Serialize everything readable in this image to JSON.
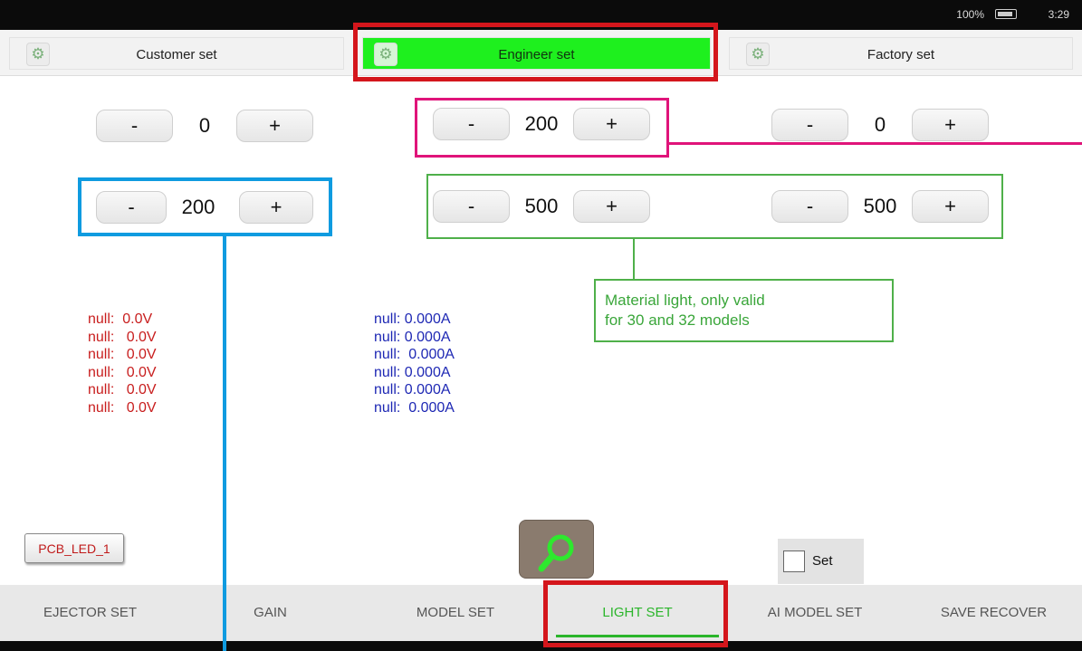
{
  "status_bar": {
    "battery": "100%",
    "time": "3:29"
  },
  "mode_tabs": [
    {
      "label": "Customer set",
      "active": false
    },
    {
      "label": "Engineer set",
      "active": true
    },
    {
      "label": "Factory set",
      "active": false
    }
  ],
  "steppers": {
    "customer_1": {
      "minus": "-",
      "value": "0",
      "plus": "+"
    },
    "customer_2": {
      "minus": "-",
      "value": "200",
      "plus": "+"
    },
    "engineer_1": {
      "minus": "-",
      "value": "200",
      "plus": "+"
    },
    "engineer_2": {
      "minus": "-",
      "value": "500",
      "plus": "+"
    },
    "factory_1": {
      "minus": "-",
      "value": "0",
      "plus": "+"
    },
    "factory_2": {
      "minus": "-",
      "value": "500",
      "plus": "+"
    }
  },
  "voltages": [
    "null:  0.0V",
    "null:   0.0V",
    "null:   0.0V",
    "null:   0.0V",
    "null:   0.0V",
    "null:   0.0V"
  ],
  "currents": [
    "null: 0.000A",
    "null: 0.000A",
    "null:  0.000A",
    "null: 0.000A",
    "null: 0.000A",
    "null:  0.000A"
  ],
  "pcb_button": "PCB_LED_1",
  "set_checkbox": {
    "label": "Set",
    "checked": false
  },
  "bottom_nav": [
    {
      "label": "EJECTOR SET",
      "active": false
    },
    {
      "label": "GAIN",
      "active": false
    },
    {
      "label": "MODEL SET",
      "active": false
    },
    {
      "label": "LIGHT SET",
      "active": true
    },
    {
      "label": "AI MODEL SET",
      "active": false
    },
    {
      "label": "SAVE RECOVER",
      "active": false
    }
  ],
  "annotation_note": {
    "line1": "Material light, only valid",
    "line2": "for 30 and 32 models"
  },
  "colors": {
    "active_tab": "#1ef01e",
    "annotation_red": "#d4161c",
    "annotation_pink": "#e0147a",
    "annotation_blue": "#0f9be0",
    "annotation_green": "#4fb04a",
    "voltage_text": "#c81e1e",
    "current_text": "#1e28b4",
    "active_nav": "#2bb52b"
  }
}
